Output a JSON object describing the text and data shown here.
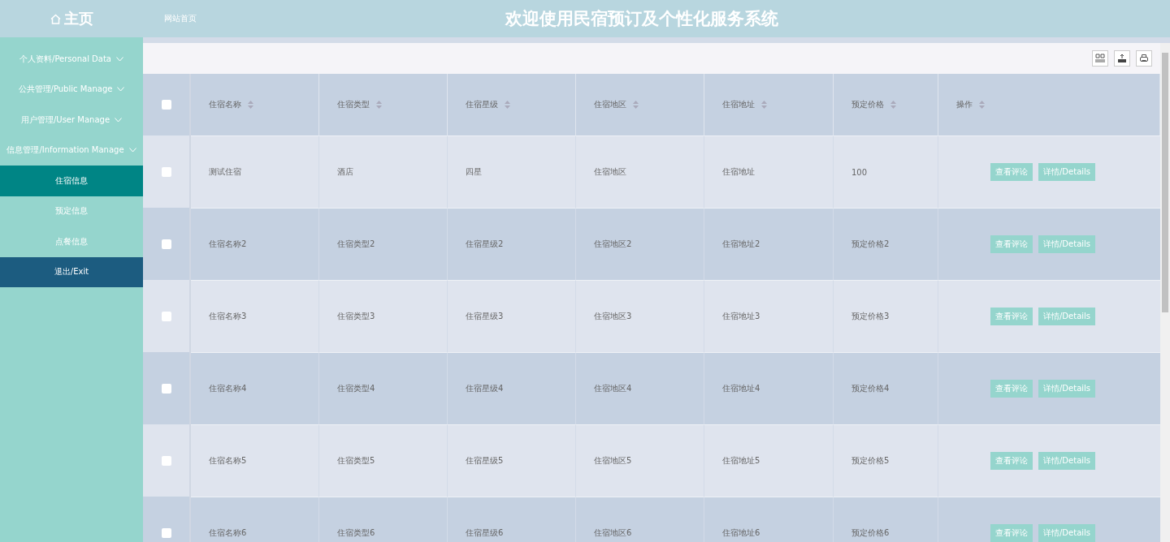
{
  "header": {
    "home": "主页",
    "link": "网站首页",
    "title": "欢迎使用民宿预订及个性化服务系统"
  },
  "sidebar": {
    "items": [
      {
        "kind": "group",
        "label": "个人资料/Personal Data",
        "selected": false
      },
      {
        "kind": "group",
        "label": "公共管理/Public Manage",
        "selected": false
      },
      {
        "kind": "group",
        "label": "用户管理/User Manage",
        "selected": false
      },
      {
        "kind": "group",
        "label": "信息管理/Information Manage",
        "selected": false
      },
      {
        "kind": "sub",
        "label": "住宿信息",
        "selected": true
      },
      {
        "kind": "sub",
        "label": "预定信息",
        "selected": false
      },
      {
        "kind": "sub",
        "label": "点餐信息",
        "selected": false
      },
      {
        "kind": "exit",
        "label": "退出/Exit",
        "selected": false
      }
    ]
  },
  "table": {
    "select_all": {
      "checked": false
    },
    "columns": [
      "住宿名称",
      "住宿类型",
      "住宿星级",
      "住宿地区",
      "住宿地址",
      "预定价格",
      "操作"
    ],
    "rows": [
      {
        "checked": false,
        "cells": [
          "测试住宿",
          "酒店",
          "四星",
          "住宿地区",
          "住宿地址",
          "100"
        ],
        "actions": [
          "查看评论",
          "详情/Details"
        ]
      },
      {
        "checked": false,
        "cells": [
          "住宿名称2",
          "住宿类型2",
          "住宿星级2",
          "住宿地区2",
          "住宿地址2",
          "预定价格2"
        ],
        "actions": [
          "查看评论",
          "详情/Details"
        ]
      },
      {
        "checked": false,
        "cells": [
          "住宿名称3",
          "住宿类型3",
          "住宿星级3",
          "住宿地区3",
          "住宿地址3",
          "预定价格3"
        ],
        "actions": [
          "查看评论",
          "详情/Details"
        ]
      },
      {
        "checked": false,
        "cells": [
          "住宿名称4",
          "住宿类型4",
          "住宿星级4",
          "住宿地区4",
          "住宿地址4",
          "预定价格4"
        ],
        "actions": [
          "查看评论",
          "详情/Details"
        ]
      },
      {
        "checked": false,
        "cells": [
          "住宿名称5",
          "住宿类型5",
          "住宿星级5",
          "住宿地区5",
          "住宿地址5",
          "预定价格5"
        ],
        "actions": [
          "查看评论",
          "详情/Details"
        ]
      },
      {
        "checked": false,
        "cells": [
          "住宿名称6",
          "住宿类型6",
          "住宿星级6",
          "住宿地区6",
          "住宿地址6",
          "预定价格6"
        ],
        "actions": [
          "查看评论",
          "详情/Details"
        ]
      }
    ]
  }
}
